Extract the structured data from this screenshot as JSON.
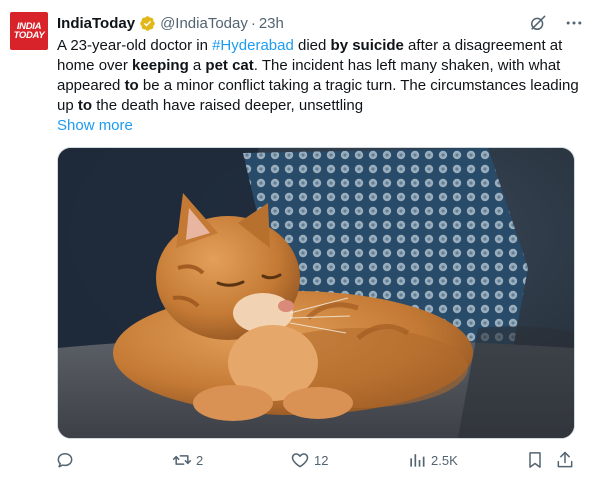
{
  "post": {
    "author_name": "IndiaToday",
    "handle": "@IndiaToday",
    "separator": "·",
    "time": "23h",
    "avatar_text_line1": "INDIA",
    "avatar_text_line2": "TODAY",
    "text": {
      "p1": "A 23-year-old doctor in ",
      "hashtag": "#Hyderabad",
      "p2": " died ",
      "b1": "by suicide",
      "p3": " after a disagreement at home over ",
      "b2": "keeping",
      "p4": " a ",
      "b3": "pet cat",
      "p5": ". The incident has left many shaken, with what appeared ",
      "b4": "to",
      "p6": " be a minor conflict taking a tragic turn. The circumstances leading up ",
      "b5": "to",
      "p7": " the death have raised deeper, unsettling"
    },
    "show_more": "Show more",
    "image_description_icon": "cat-photo"
  },
  "actions": {
    "reply_count": "",
    "repost_count": "2",
    "like_count": "12",
    "views_count": "2.5K"
  },
  "colors": {
    "accent": "#1d9bf0",
    "secondary_text": "#536471",
    "avatar_bg": "#d8232a",
    "verified_badge": "#e2b719"
  }
}
